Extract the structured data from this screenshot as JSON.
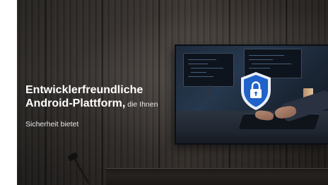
{
  "hero": {
    "title_line1": "Entwicklerfreundliche",
    "title_line2": "Android-Plattform,",
    "title_suffix": " die Ihnen",
    "subtitle": "Sicherheit bietet"
  },
  "icons": {
    "shield": "shield-lock-icon"
  },
  "colors": {
    "shield_fill": "#1f62c9",
    "shield_border": "#e9eef6",
    "background_wood": "#3a3532",
    "text": "#ffffff"
  }
}
